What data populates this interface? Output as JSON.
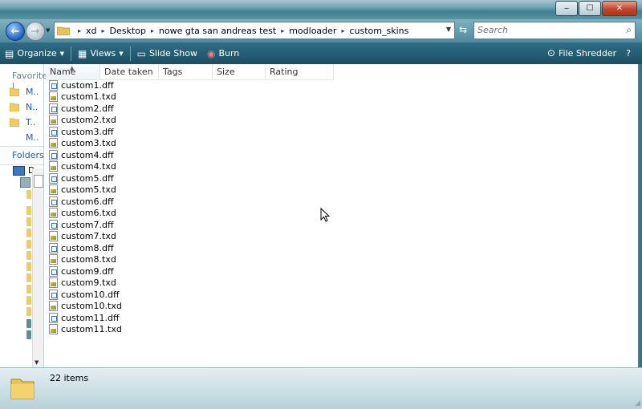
{
  "window": {
    "controls": {
      "minimize": "‒",
      "maximize": "☐",
      "close": "✕"
    }
  },
  "navigation": {
    "back_icon": "←",
    "forward_icon": "→",
    "breadcrumbs": [
      "xd",
      "Desktop",
      "nowe gta san andreas test",
      "modloader",
      "custom_skins"
    ],
    "search_placeholder": "Search",
    "refresh_icon": "⇆",
    "search_icon": "⌕"
  },
  "toolbar": {
    "organize": "Organize",
    "views": "Views",
    "slideshow": "Slide Show",
    "burn": "Burn",
    "file_shredder": "File Shredder",
    "help_icon": "?"
  },
  "left_pane": {
    "favorites_label": "Favorite l",
    "favorites": [
      "M..",
      "N..",
      "T..",
      "M.."
    ],
    "folders_label": "Folders",
    "tree_root": "D"
  },
  "columns": [
    "Name",
    "Date taken",
    "Tags",
    "Size",
    "Rating"
  ],
  "files": [
    {
      "name": "custom1.dff",
      "type": "dff"
    },
    {
      "name": "custom1.txd",
      "type": "txd"
    },
    {
      "name": "custom2.dff",
      "type": "dff"
    },
    {
      "name": "custom2.txd",
      "type": "txd"
    },
    {
      "name": "custom3.dff",
      "type": "dff"
    },
    {
      "name": "custom3.txd",
      "type": "txd"
    },
    {
      "name": "custom4.dff",
      "type": "dff"
    },
    {
      "name": "custom4.txd",
      "type": "txd"
    },
    {
      "name": "custom5.dff",
      "type": "dff"
    },
    {
      "name": "custom5.txd",
      "type": "txd"
    },
    {
      "name": "custom6.dff",
      "type": "dff"
    },
    {
      "name": "custom6.txd",
      "type": "txd"
    },
    {
      "name": "custom7.dff",
      "type": "dff"
    },
    {
      "name": "custom7.txd",
      "type": "txd"
    },
    {
      "name": "custom8.dff",
      "type": "dff"
    },
    {
      "name": "custom8.txd",
      "type": "txd"
    },
    {
      "name": "custom9.dff",
      "type": "dff"
    },
    {
      "name": "custom9.txd",
      "type": "txd"
    },
    {
      "name": "custom10.dff",
      "type": "dff"
    },
    {
      "name": "custom10.txd",
      "type": "txd"
    },
    {
      "name": "custom11.dff",
      "type": "dff"
    },
    {
      "name": "custom11.txd",
      "type": "txd"
    }
  ],
  "status": {
    "item_count": "22 items"
  },
  "colors": {
    "toolbar": "#1a4f65",
    "link": "#1f5bb3",
    "folder": "#f0cd5c"
  }
}
